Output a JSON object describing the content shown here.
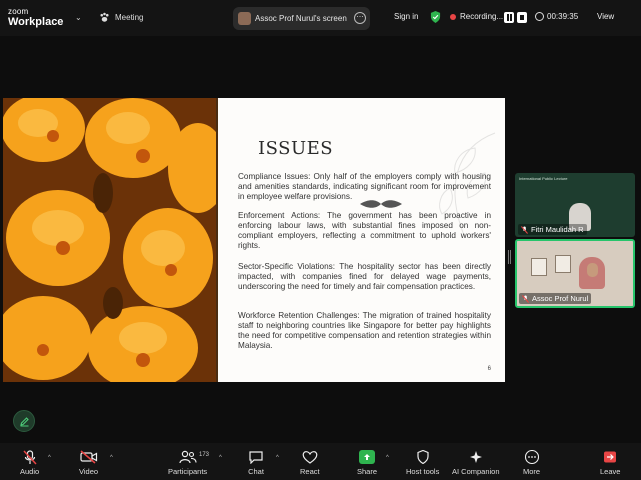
{
  "app": {
    "logo_line1": "zoom",
    "logo_line2": "Workplace"
  },
  "topbar": {
    "meeting_label": "Meeting",
    "screen_share_label": "Assoc Prof Nurul's screen",
    "signin_label": "Sign in",
    "recording_label": "Recording...",
    "timer": "00:39:35",
    "view_label": "View"
  },
  "slide": {
    "title": "ISSUES",
    "paragraphs": [
      "Compliance Issues: Only half of the employers comply with housing and amenities standards, indicating significant room for improvement in employee welfare provisions.",
      "Enforcement Actions: The government has been proactive in enforcing labour laws, with substantial fines imposed on non-compliant employers, reflecting a commitment to uphold workers' rights.",
      "Sector-Specific Violations: The hospitality sector has been directly impacted, with companies fined for delayed wage payments, underscoring the need for timely and fair compensation practices.",
      "Workforce Retention Challenges: The migration of trained hospitality staff to neighboring countries like Singapore for better pay highlights the need for competitive compensation and retention strategies within Malaysia."
    ],
    "page_number": "6"
  },
  "participants": [
    {
      "name": "Fitri Maulidah R",
      "header_text": "International Public Lecture",
      "muted": true
    },
    {
      "name": "Assoc Prof Nurul",
      "muted": true,
      "active_speaker": true
    }
  ],
  "toolbar": {
    "audio": "Audio",
    "video": "Video",
    "participants": "Participants",
    "participant_count": "173",
    "chat": "Chat",
    "react": "React",
    "share": "Share",
    "host_tools": "Host tools",
    "ai_companion": "AI Companion",
    "more": "More",
    "leave": "Leave"
  },
  "colors": {
    "accent_green": "#27c46b",
    "record_red": "#e84545",
    "leave_red": "#e84545",
    "share_green": "#2fb44f"
  }
}
